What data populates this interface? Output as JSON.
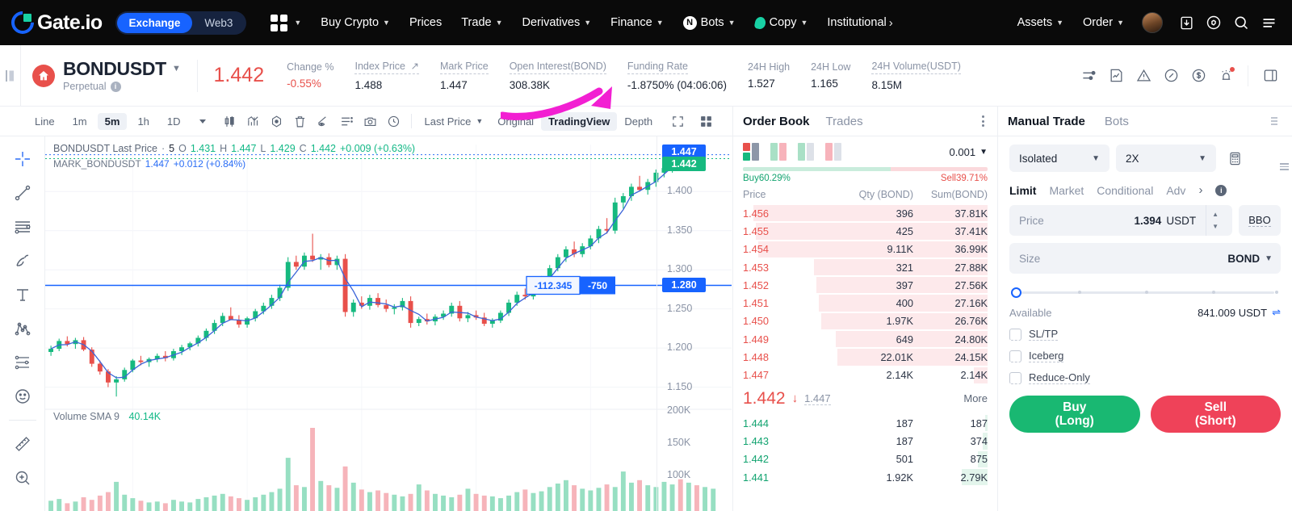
{
  "topnav": {
    "brand": "Gate.io",
    "segments": [
      {
        "label": "Exchange",
        "active": true
      },
      {
        "label": "Web3",
        "active": false
      }
    ],
    "menu": [
      {
        "label": "Buy Crypto",
        "caret": true
      },
      {
        "label": "Prices",
        "caret": false
      },
      {
        "label": "Trade",
        "caret": true
      },
      {
        "label": "Derivatives",
        "caret": true
      },
      {
        "label": "Finance",
        "caret": true
      },
      {
        "label": "Bots",
        "caret": true,
        "badge": "N"
      },
      {
        "label": "Copy",
        "caret": true,
        "leaf": true
      },
      {
        "label": "Institutional",
        "caret": false,
        "arrow": true
      }
    ],
    "right": [
      {
        "label": "Assets",
        "caret": true
      },
      {
        "label": "Order",
        "caret": true
      }
    ],
    "icons": [
      "avatar",
      "download-icon",
      "hexagon-icon",
      "search-icon",
      "menu-icon"
    ]
  },
  "ticker": {
    "symbol": "BONDUSDT",
    "contract_type": "Perpetual",
    "last_price": "1.442",
    "stats": [
      {
        "label": "Change %",
        "value": "-0.55%",
        "red": true,
        "dashed": false,
        "arrow": false
      },
      {
        "label": "Index Price",
        "value": "1.488",
        "red": false,
        "dashed": true,
        "arrow": true
      },
      {
        "label": "Mark Price",
        "value": "1.447",
        "red": false,
        "dashed": true,
        "arrow": false
      },
      {
        "label": "Open Interest(BOND)",
        "value": "308.38K",
        "red": false,
        "dashed": true,
        "arrow": false
      },
      {
        "label": "Funding Rate",
        "value": "-1.8750% (04:06:06)",
        "red": false,
        "dashed": true,
        "arrow": false
      },
      {
        "label": "24H High",
        "value": "1.527",
        "red": false,
        "dashed": false,
        "arrow": false
      },
      {
        "label": "24H Low",
        "value": "1.165",
        "red": false,
        "dashed": false,
        "arrow": false
      },
      {
        "label": "24H Volume(USDT)",
        "value": "8.15M",
        "red": false,
        "dashed": true,
        "arrow": false
      }
    ],
    "icons": [
      "sliders-icon",
      "note-chart-icon",
      "alert-triangle-icon",
      "compass-icon",
      "dollar-circle-icon",
      "bell-alarm-icon",
      "layout-icon"
    ]
  },
  "chart_toolbar": {
    "chart_type": "Line",
    "timeframes": [
      {
        "label": "1m",
        "active": false
      },
      {
        "label": "5m",
        "active": true
      },
      {
        "label": "1h",
        "active": false
      },
      {
        "label": "1D",
        "active": false
      }
    ],
    "tools": [
      "candle-icon",
      "indicator-icon",
      "compare-icon",
      "trash-icon",
      "hide-drawings-icon",
      "list-icon",
      "camera-icon",
      "replay-icon"
    ],
    "price_source": "Last Price",
    "views": [
      {
        "label": "Original",
        "active": false
      },
      {
        "label": "TradingView",
        "active": true
      },
      {
        "label": "Depth",
        "active": false
      }
    ],
    "fullscreen_icon": "expand-icon",
    "layout_icon": "grid-layout-icon"
  },
  "draw_tools": [
    "crosshair-icon",
    "trendline-icon",
    "horizontal-lines-icon",
    "brush-icon",
    "text-icon",
    "pattern-icon",
    "fib-icon",
    "emoji-icon",
    "ruler-icon",
    "zoom-in-icon"
  ],
  "chart_data": {
    "type": "line",
    "title": "BONDUSDT Last Price",
    "interval": "5",
    "legend": {
      "symbol": "BONDUSDT Last Price",
      "interval_label": "5",
      "open_label": "O",
      "open": "1.431",
      "high_label": "H",
      "high": "1.447",
      "low_label": "L",
      "low": "1.429",
      "close_label": "C",
      "close": "1.442",
      "change": "+0.009 (+0.63%)",
      "mark_series": "MARK_BONDUSDT",
      "mark_value": "1.447",
      "mark_change": "+0.012 (+0.84%)"
    },
    "volume_legend": {
      "label": "Volume SMA 9",
      "value": "40.14K"
    },
    "price_axis_ticks": [
      "1.400",
      "1.350",
      "1.300",
      "1.250",
      "1.200",
      "1.150"
    ],
    "volume_axis_ticks": [
      "200K",
      "150K",
      "100K"
    ],
    "price_badges": [
      {
        "value": "1.447",
        "color": "#1763ff",
        "kind": "mark"
      },
      {
        "value": "1.442",
        "color": "#16b97f",
        "kind": "last"
      },
      {
        "value": "1.280",
        "color": "#1763ff",
        "kind": "position"
      }
    ],
    "position_line": {
      "pnl": "-112.345",
      "size": "-750",
      "price_level": "1.280"
    },
    "ylim": [
      1.13,
      1.46
    ],
    "candles": [
      [
        1.195,
        1.203,
        1.19,
        1.199
      ],
      [
        1.199,
        1.212,
        1.196,
        1.209
      ],
      [
        1.209,
        1.215,
        1.202,
        1.205
      ],
      [
        1.205,
        1.213,
        1.199,
        1.21
      ],
      [
        1.21,
        1.214,
        1.196,
        1.198
      ],
      [
        1.198,
        1.201,
        1.176,
        1.18
      ],
      [
        1.18,
        1.184,
        1.166,
        1.17
      ],
      [
        1.17,
        1.173,
        1.15,
        1.156
      ],
      [
        1.156,
        1.164,
        1.138,
        1.16
      ],
      [
        1.16,
        1.175,
        1.157,
        1.172
      ],
      [
        1.172,
        1.186,
        1.169,
        1.184
      ],
      [
        1.184,
        1.19,
        1.178,
        1.182
      ],
      [
        1.182,
        1.188,
        1.176,
        1.186
      ],
      [
        1.186,
        1.193,
        1.182,
        1.19
      ],
      [
        1.19,
        1.196,
        1.183,
        1.187
      ],
      [
        1.187,
        1.199,
        1.184,
        1.196
      ],
      [
        1.196,
        1.204,
        1.191,
        1.201
      ],
      [
        1.201,
        1.208,
        1.197,
        1.206
      ],
      [
        1.206,
        1.216,
        1.202,
        1.213
      ],
      [
        1.213,
        1.225,
        1.209,
        1.222
      ],
      [
        1.222,
        1.236,
        1.218,
        1.232
      ],
      [
        1.232,
        1.245,
        1.228,
        1.241
      ],
      [
        1.241,
        1.252,
        1.237,
        1.236
      ],
      [
        1.236,
        1.242,
        1.226,
        1.23
      ],
      [
        1.23,
        1.24,
        1.226,
        1.238
      ],
      [
        1.238,
        1.25,
        1.234,
        1.247
      ],
      [
        1.247,
        1.258,
        1.243,
        1.254
      ],
      [
        1.254,
        1.268,
        1.25,
        1.264
      ],
      [
        1.264,
        1.281,
        1.26,
        1.277
      ],
      [
        1.277,
        1.316,
        1.273,
        1.31
      ],
      [
        1.31,
        1.318,
        1.3,
        1.304
      ],
      [
        1.304,
        1.322,
        1.3,
        1.318
      ],
      [
        1.318,
        1.346,
        1.31,
        1.313
      ],
      [
        1.313,
        1.32,
        1.3,
        1.316
      ],
      [
        1.316,
        1.321,
        1.303,
        1.306
      ],
      [
        1.306,
        1.318,
        1.3,
        1.314
      ],
      [
        1.314,
        1.32,
        1.24,
        1.246
      ],
      [
        1.246,
        1.262,
        1.24,
        1.258
      ],
      [
        1.258,
        1.266,
        1.25,
        1.254
      ],
      [
        1.254,
        1.268,
        1.249,
        1.264
      ],
      [
        1.264,
        1.27,
        1.252,
        1.255
      ],
      [
        1.255,
        1.262,
        1.246,
        1.25
      ],
      [
        1.25,
        1.256,
        1.243,
        1.252
      ],
      [
        1.252,
        1.264,
        1.248,
        1.26
      ],
      [
        1.26,
        1.266,
        1.226,
        1.232
      ],
      [
        1.232,
        1.24,
        1.228,
        1.237
      ],
      [
        1.237,
        1.244,
        1.23,
        1.234
      ],
      [
        1.234,
        1.243,
        1.229,
        1.24
      ],
      [
        1.24,
        1.248,
        1.236,
        1.244
      ],
      [
        1.244,
        1.258,
        1.24,
        1.254
      ],
      [
        1.254,
        1.26,
        1.234,
        1.238
      ],
      [
        1.238,
        1.246,
        1.233,
        1.242
      ],
      [
        1.242,
        1.248,
        1.236,
        1.239
      ],
      [
        1.239,
        1.245,
        1.228,
        1.231
      ],
      [
        1.231,
        1.238,
        1.226,
        1.235
      ],
      [
        1.235,
        1.248,
        1.232,
        1.245
      ],
      [
        1.245,
        1.262,
        1.241,
        1.258
      ],
      [
        1.258,
        1.272,
        1.254,
        1.268
      ],
      [
        1.268,
        1.276,
        1.262,
        1.266
      ],
      [
        1.266,
        1.28,
        1.262,
        1.277
      ],
      [
        1.277,
        1.292,
        1.272,
        1.288
      ],
      [
        1.288,
        1.306,
        1.284,
        1.302
      ],
      [
        1.302,
        1.32,
        1.298,
        1.316
      ],
      [
        1.316,
        1.33,
        1.31,
        1.326
      ],
      [
        1.326,
        1.336,
        1.316,
        1.32
      ],
      [
        1.32,
        1.334,
        1.316,
        1.33
      ],
      [
        1.33,
        1.344,
        1.326,
        1.34
      ],
      [
        1.34,
        1.356,
        1.334,
        1.352
      ],
      [
        1.352,
        1.366,
        1.346,
        1.35
      ],
      [
        1.35,
        1.392,
        1.346,
        1.386
      ],
      [
        1.386,
        1.398,
        1.378,
        1.394
      ],
      [
        1.394,
        1.41,
        1.388,
        1.406
      ],
      [
        1.406,
        1.42,
        1.4,
        1.402
      ],
      [
        1.402,
        1.416,
        1.396,
        1.412
      ],
      [
        1.412,
        1.428,
        1.406,
        1.424
      ],
      [
        1.424,
        1.436,
        1.418,
        1.43
      ],
      [
        1.43,
        1.444,
        1.424,
        1.44
      ],
      [
        1.44,
        1.452,
        1.432,
        1.436
      ],
      [
        1.436,
        1.449,
        1.43,
        1.445
      ],
      [
        1.445,
        1.45,
        1.438,
        1.442
      ]
    ],
    "volume_bars": [
      12,
      14,
      9,
      11,
      16,
      13,
      18,
      22,
      34,
      19,
      15,
      12,
      10,
      11,
      9,
      13,
      11,
      10,
      14,
      16,
      18,
      20,
      17,
      15,
      13,
      16,
      19,
      22,
      26,
      62,
      30,
      28,
      97,
      35,
      30,
      27,
      52,
      33,
      25,
      22,
      24,
      21,
      19,
      17,
      20,
      31,
      24,
      20,
      18,
      16,
      19,
      26,
      20,
      18,
      17,
      15,
      18,
      22,
      25,
      21,
      23,
      28,
      32,
      36,
      30,
      26,
      24,
      27,
      31,
      28,
      46,
      33,
      36,
      30,
      28,
      34,
      31,
      37,
      33,
      30,
      28,
      26
    ]
  },
  "order_book": {
    "tabs": [
      {
        "label": "Order Book",
        "active": true
      },
      {
        "label": "Trades",
        "active": false
      }
    ],
    "depth_value": "0.001",
    "buy_ratio_label": "Buy60.29%",
    "sell_ratio_label": "Sell39.71%",
    "buy_ratio": 60.29,
    "sell_ratio": 39.71,
    "columns": [
      "Price",
      "Qty (BOND)",
      "Sum(BOND)"
    ],
    "asks": [
      {
        "price": "1.456",
        "qty": "396",
        "sum": "37.81K",
        "fill": 100
      },
      {
        "price": "1.455",
        "qty": "425",
        "sum": "37.41K",
        "fill": 99
      },
      {
        "price": "1.454",
        "qty": "9.11K",
        "sum": "36.99K",
        "fill": 98
      },
      {
        "price": "1.453",
        "qty": "321",
        "sum": "27.88K",
        "fill": 74
      },
      {
        "price": "1.452",
        "qty": "397",
        "sum": "27.56K",
        "fill": 73
      },
      {
        "price": "1.451",
        "qty": "400",
        "sum": "27.16K",
        "fill": 72
      },
      {
        "price": "1.450",
        "qty": "1.97K",
        "sum": "26.76K",
        "fill": 71
      },
      {
        "price": "1.449",
        "qty": "649",
        "sum": "24.80K",
        "fill": 65
      },
      {
        "price": "1.448",
        "qty": "22.01K",
        "sum": "24.15K",
        "fill": 64
      },
      {
        "price": "1.447",
        "qty": "2.14K",
        "sum": "2.14K",
        "fill": 6
      }
    ],
    "mid": {
      "price": "1.442",
      "arrow": "↓",
      "mark": "1.447",
      "more_label": "More"
    },
    "bids": [
      {
        "price": "1.444",
        "qty": "187",
        "sum": "187",
        "fill": 1
      },
      {
        "price": "1.443",
        "qty": "187",
        "sum": "374",
        "fill": 2
      },
      {
        "price": "1.442",
        "qty": "501",
        "sum": "875",
        "fill": 4
      },
      {
        "price": "1.441",
        "qty": "1.92K",
        "sum": "2.79K",
        "fill": 11
      }
    ]
  },
  "trade_panel": {
    "tabs": [
      {
        "label": "Manual Trade",
        "active": true
      },
      {
        "label": "Bots",
        "active": false
      }
    ],
    "margin_mode": "Isolated",
    "leverage": "2X",
    "calculator_icon": "calculator-icon",
    "order_types": [
      {
        "label": "Limit",
        "active": true
      },
      {
        "label": "Market",
        "active": false
      },
      {
        "label": "Conditional",
        "active": false
      },
      {
        "label": "Adv",
        "active": false
      }
    ],
    "price": {
      "label": "Price",
      "value": "1.394",
      "unit": "USDT",
      "bbo_label": "BBO"
    },
    "size": {
      "label": "Size",
      "placeholder": "",
      "unit": "BOND"
    },
    "slider_percent": 0,
    "available": {
      "label": "Available",
      "value": "841.009 USDT"
    },
    "checkboxes": [
      {
        "label": "SL/TP",
        "checked": false
      },
      {
        "label": "Iceberg",
        "checked": false
      },
      {
        "label": "Reduce-Only",
        "checked": false
      }
    ],
    "buy_button": {
      "line1": "Buy",
      "line2": "(Long)"
    },
    "sell_button": {
      "line1": "Sell",
      "line2": "(Short)"
    }
  },
  "colors": {
    "up": "#16b97f",
    "down": "#e8504b",
    "accent": "#1763ff",
    "buy": "#19b872",
    "sell": "#ef4259"
  }
}
